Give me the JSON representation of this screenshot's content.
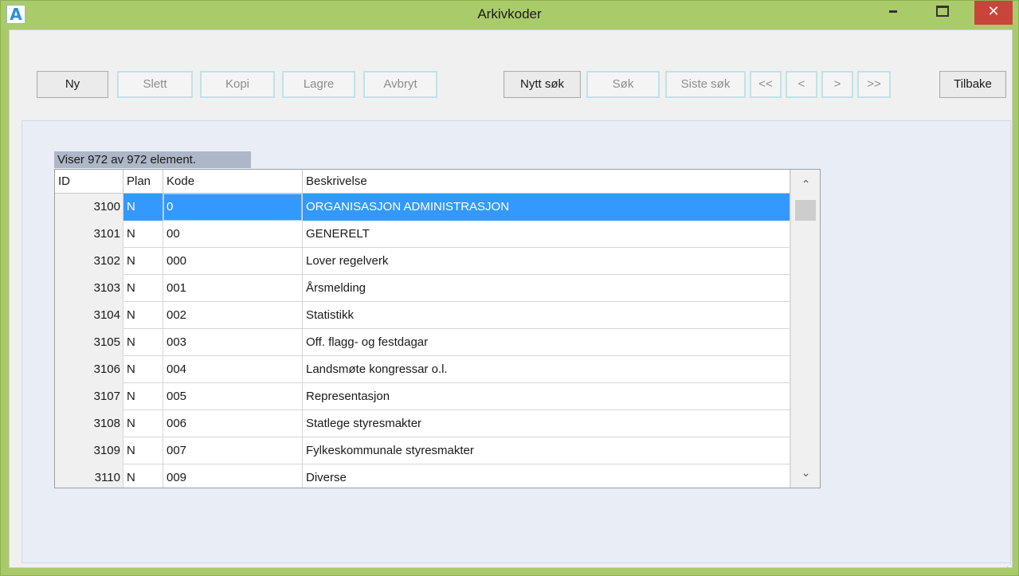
{
  "window": {
    "title": "Arkivkoder",
    "icon_letter": "A",
    "close_glyph": "✕"
  },
  "toolbar": {
    "ny": "Ny",
    "slett": "Slett",
    "kopi": "Kopi",
    "lagre": "Lagre",
    "avbryt": "Avbryt",
    "nytt_sok": "Nytt søk",
    "sok": "Søk",
    "siste_sok": "Siste søk",
    "first": "<<",
    "prev": "<",
    "next": ">",
    "last": ">>",
    "tilbake": "Tilbake"
  },
  "status": "Viser 972 av 972 element.",
  "grid": {
    "columns": [
      "ID",
      "Plan",
      "Kode",
      "Beskrivelse"
    ],
    "rows": [
      {
        "id": "3100",
        "plan": "N",
        "kode": "0",
        "beskrivelse": "ORGANISASJON ADMINISTRASJON",
        "selected": true
      },
      {
        "id": "3101",
        "plan": "N",
        "kode": "00",
        "beskrivelse": "GENERELT"
      },
      {
        "id": "3102",
        "plan": "N",
        "kode": "000",
        "beskrivelse": "Lover regelverk"
      },
      {
        "id": "3103",
        "plan": "N",
        "kode": "001",
        "beskrivelse": "Årsmelding"
      },
      {
        "id": "3104",
        "plan": "N",
        "kode": "002",
        "beskrivelse": "Statistikk"
      },
      {
        "id": "3105",
        "plan": "N",
        "kode": "003",
        "beskrivelse": "Off. flagg- og festdagar"
      },
      {
        "id": "3106",
        "plan": "N",
        "kode": "004",
        "beskrivelse": "Landsmøte kongressar o.l."
      },
      {
        "id": "3107",
        "plan": "N",
        "kode": "005",
        "beskrivelse": "Representasjon"
      },
      {
        "id": "3108",
        "plan": "N",
        "kode": "006",
        "beskrivelse": "Statlege styresmakter"
      },
      {
        "id": "3109",
        "plan": "N",
        "kode": "007",
        "beskrivelse": "Fylkeskommunale  styresmakter"
      },
      {
        "id": "3110",
        "plan": "N",
        "kode": "009",
        "beskrivelse": "Diverse"
      }
    ],
    "scroll_up_glyph": "⌃",
    "scroll_down_glyph": "⌄"
  },
  "colors": {
    "titlebar": "#aacb6a",
    "close_button": "#c9443a",
    "selection": "#3399ff",
    "status_label_bg": "#adb7c7",
    "content_bg": "#e8edf6"
  }
}
